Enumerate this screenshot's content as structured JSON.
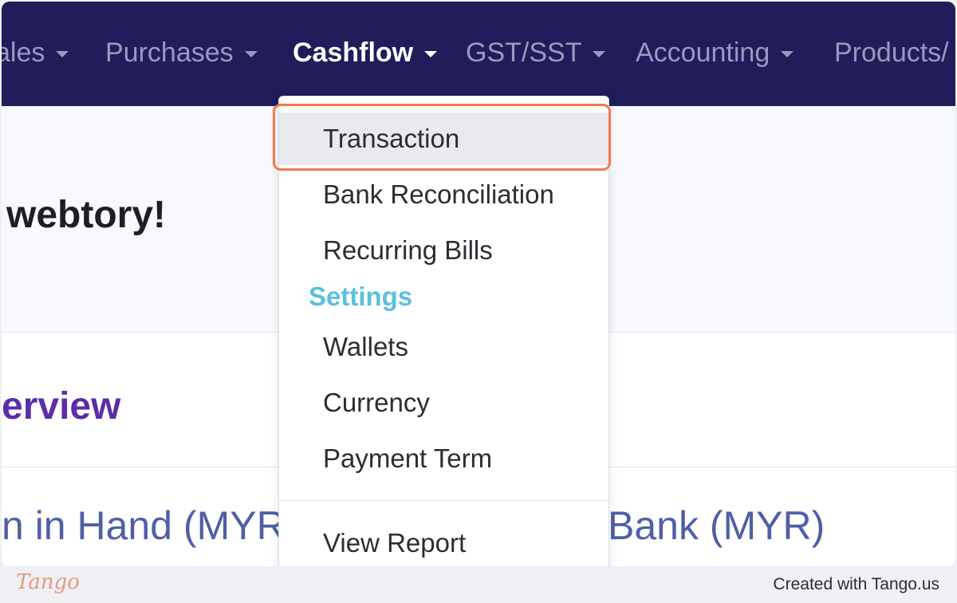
{
  "nav": {
    "items": [
      {
        "label": "ales"
      },
      {
        "label": "Purchases"
      },
      {
        "label": "Cashflow"
      },
      {
        "label": "GST/SST"
      },
      {
        "label": "Accounting"
      },
      {
        "label": "Products/"
      }
    ]
  },
  "page": {
    "welcome": "webtory!",
    "overview": "erview",
    "cash_label": "n in Hand (MYR)",
    "bank_label": "Bank (MYR)"
  },
  "dropdown": {
    "items": [
      {
        "label": "Transaction"
      },
      {
        "label": "Bank Reconciliation"
      },
      {
        "label": "Recurring Bills"
      }
    ],
    "settings_heading": "Settings",
    "settings_items": [
      {
        "label": "Wallets"
      },
      {
        "label": "Currency"
      },
      {
        "label": "Payment Term"
      }
    ],
    "report": "View Report"
  },
  "footer": {
    "logo": "Tango",
    "credit": "Created with Tango.us"
  },
  "colors": {
    "navbar": "#211c5a",
    "highlight": "#f07a4e",
    "settings_heading": "#5bc0de",
    "overview": "#5c2da8"
  }
}
